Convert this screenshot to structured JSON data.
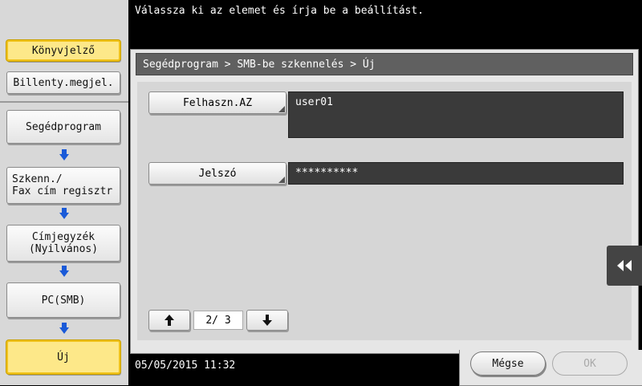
{
  "top_message": "Válassza ki az elemet és írja be a beállítást.",
  "sidebar": {
    "bookmark_label": "Könyvjelző",
    "keyboard_label": "Billenty.megjel.",
    "steps": [
      "Segédprogram",
      "Szkenn./\nFax cím regisztr",
      "Címjegyzék\n(Nyilvános)",
      "PC(SMB)",
      "Új"
    ]
  },
  "breadcrumb": "Segédprogram > SMB-be szkennelés > Új",
  "fields": [
    {
      "label": "Felhaszn.AZ",
      "value": "user01"
    },
    {
      "label": "Jelszó",
      "value": "**********"
    }
  ],
  "pagination": {
    "indicator": "2/ 3",
    "current": 2,
    "total": 3
  },
  "buttons": {
    "cancel": "Mégse",
    "ok": "OK"
  },
  "datetime": "05/05/2015  11:32",
  "colors": {
    "highlight": "#fde889",
    "highlight_border": "#f0c21a",
    "arrow_blue": "#1a5ad8",
    "field_bg": "#3a3a3a"
  }
}
